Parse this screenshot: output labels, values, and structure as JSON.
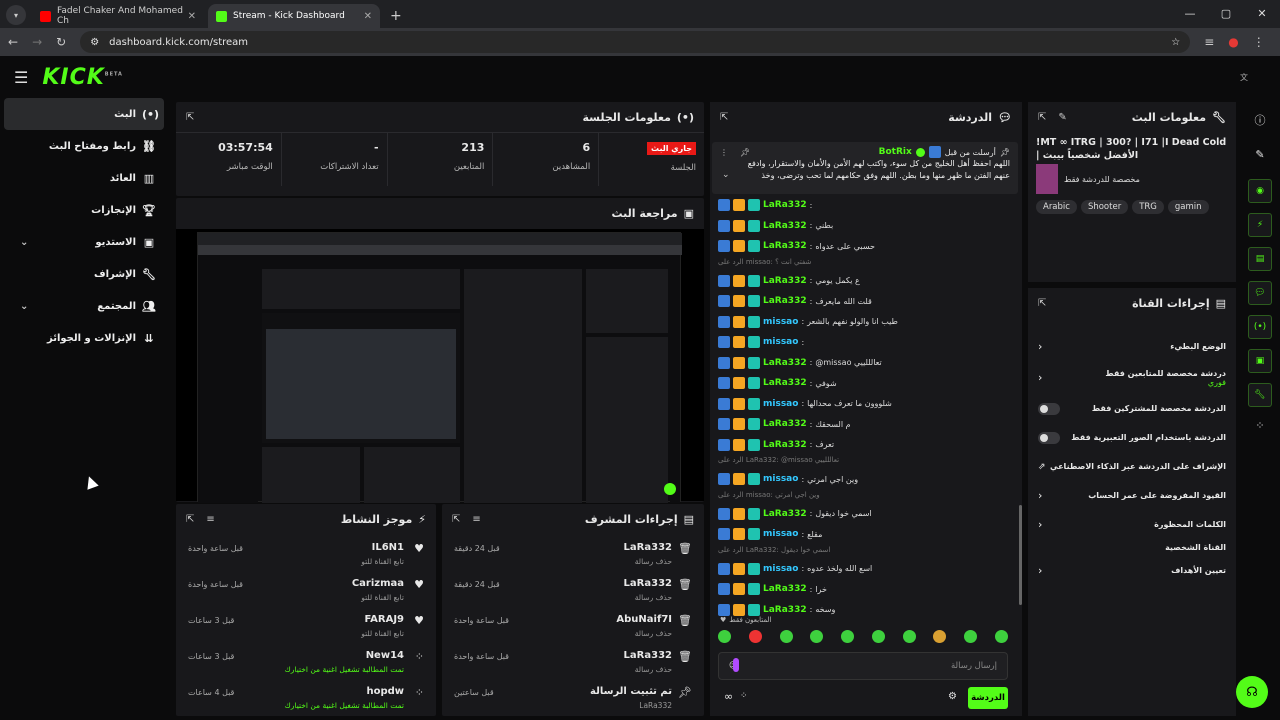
{
  "browser": {
    "tabs": [
      {
        "title": "Fadel Chaker And Mohamed Ch",
        "favicon_color": "#ff0000"
      },
      {
        "title": "Stream - Kick Dashboard",
        "favicon_color": "#53fc18"
      }
    ],
    "url": "dashboard.kick.com/stream"
  },
  "header": {
    "logo": "KICK",
    "logo_beta": "BETA"
  },
  "sidebar": {
    "items": [
      {
        "label": "البث",
        "icon": "broadcast-icon"
      },
      {
        "label": "رابط ومفتاح البث",
        "icon": "link-icon"
      },
      {
        "label": "العائد",
        "icon": "chart-icon"
      },
      {
        "label": "الإنجازات",
        "icon": "trophy-icon"
      },
      {
        "label": "الاستديو",
        "icon": "studio-icon"
      },
      {
        "label": "الإشراف",
        "icon": "wrench-icon"
      },
      {
        "label": "المجتمع",
        "icon": "community-icon"
      },
      {
        "label": "الإنزالات و الجوائز",
        "icon": "drops-icon"
      }
    ]
  },
  "session": {
    "title": "معلومات الجلسة",
    "live_badge": "جاري البث",
    "stats": [
      {
        "value": "03:57:54",
        "label": "الوقت مباشر"
      },
      {
        "value": "-",
        "label": "تعداد الاشتراكات"
      },
      {
        "value": "213",
        "label": "المتابعين"
      },
      {
        "value": "6",
        "label": "المشاهدين"
      },
      {
        "value": "",
        "label": "الجلسة"
      }
    ]
  },
  "preview": {
    "title": "مراجعة البث"
  },
  "activity": {
    "title": "موجز النشاط",
    "rows": [
      {
        "name": "IL6N1",
        "desc": "تابع القناة للتو",
        "time": "قبل ساعة واحدة",
        "icon": "heart-icon",
        "highlight": false
      },
      {
        "name": "Carizmaa",
        "desc": "تابع القناة للتو",
        "time": "قبل ساعة واحدة",
        "icon": "heart-icon",
        "highlight": false
      },
      {
        "name": "FARAJ9",
        "desc": "تابع القناة للتو",
        "time": "قبل 3 ساعات",
        "icon": "heart-icon",
        "highlight": false
      },
      {
        "name": "New14",
        "desc": "تمت المطالبة تشغيل اغنية من اختيارك",
        "time": "قبل 3 ساعات",
        "icon": "points-icon",
        "highlight": true
      },
      {
        "name": "hopdw",
        "desc": "تمت المطالبة تشغيل اغنية من اختيارك",
        "time": "قبل 4 ساعات",
        "icon": "points-icon",
        "highlight": true
      }
    ]
  },
  "modactions": {
    "title": "إجراءات المشرف",
    "rows": [
      {
        "name": "LaRa332",
        "desc": "حذف رسالة",
        "time": "قبل 24 دقيقة",
        "icon": "trash-icon"
      },
      {
        "name": "LaRa332",
        "desc": "حذف رسالة",
        "time": "قبل 24 دقيقة",
        "icon": "trash-icon"
      },
      {
        "name": "AbuNaif7I",
        "desc": "حذف رسالة",
        "time": "قبل ساعة واحدة",
        "icon": "trash-icon"
      },
      {
        "name": "LaRa332",
        "desc": "حذف رسالة",
        "time": "قبل ساعة واحدة",
        "icon": "trash-icon"
      },
      {
        "name": "تم تثبيت الرسالة",
        "desc": "LaRa332",
        "time": "قبل ساعتين",
        "icon": "pin-icon"
      }
    ]
  },
  "chat": {
    "title": "الدردشة",
    "pinned_by": "أرسلت من قبل",
    "pinned_user": "BotRix",
    "pinned_text": "اللهم احفظ أهل الخليج من كل سوء، واكتب لهم الأمن والأمان والاستقرار، وادفع عنهم الفتن ما ظهر منها وما بطن. اللهم وفق حكامهم لما تحب وترضى، وخذ بنواصيهم البر...",
    "messages": [
      {
        "user": "LaRa332",
        "msg": "",
        "reply": "",
        "color": "#53fc18"
      },
      {
        "user": "LaRa332",
        "msg": "بطني",
        "reply": "",
        "color": "#53fc18"
      },
      {
        "user": "LaRa332",
        "msg": "حسبي على عدواه",
        "reply": "",
        "color": "#53fc18"
      },
      {
        "user": "LaRa332",
        "msg": "ع يكمل يومي",
        "reply": "الرد على missao: شفتي انت ؟",
        "color": "#53fc18"
      },
      {
        "user": "LaRa332",
        "msg": "قلت الله مايعرف",
        "reply": "",
        "color": "#53fc18"
      },
      {
        "user": "missao",
        "msg": "طيب انا والولو نفهم بالشعر",
        "reply": "",
        "color": "#33c8ff"
      },
      {
        "user": "missao",
        "msg": "",
        "reply": "",
        "color": "#33c8ff"
      },
      {
        "user": "LaRa332",
        "msg": "@missao تعالللييي",
        "reply": "",
        "color": "#53fc18"
      },
      {
        "user": "LaRa332",
        "msg": "شوفي",
        "reply": "",
        "color": "#53fc18"
      },
      {
        "user": "missao",
        "msg": "شلووون ما تعرف محدالها",
        "reply": "",
        "color": "#33c8ff"
      },
      {
        "user": "LaRa332",
        "msg": "م السحقك",
        "reply": "",
        "color": "#53fc18"
      },
      {
        "user": "LaRa332",
        "msg": "تعرف",
        "reply": "",
        "color": "#53fc18"
      },
      {
        "user": "missao",
        "msg": "وين اجي امرتي",
        "reply": "الرد على LaRa332: @missao تعالللييي",
        "color": "#33c8ff"
      },
      {
        "user": "LaRa332",
        "msg": "اسمي خوا ديقول",
        "reply": "الرد على missao: وين اجي امرتي",
        "color": "#53fc18"
      },
      {
        "user": "missao",
        "msg": "مقلع",
        "reply": "",
        "color": "#33c8ff"
      },
      {
        "user": "missao",
        "msg": "اسع الله ولخذ عدوه",
        "reply": "الرد على LaRa332: اسمي خوا ديقول",
        "color": "#33c8ff"
      },
      {
        "user": "LaRa332",
        "msg": "خرا",
        "reply": "",
        "color": "#53fc18"
      },
      {
        "user": "LaRa332",
        "msg": "وسخه",
        "reply": "",
        "color": "#53fc18"
      }
    ],
    "followers_only": "المتابعون فقط",
    "input_placeholder": "إرسال رسالة",
    "send_label": "الدردشة"
  },
  "stream_info": {
    "title": "معلومات البث",
    "stream_title": "!MT ∞ ITRG | 300? | I71 |I Dead Cold | الأفضل شخصياً بيبث",
    "category": "مخصصة للدردشة فقط",
    "tags": [
      "Arabic",
      "Shooter",
      "TRG",
      "gamin"
    ]
  },
  "channel_actions": {
    "title": "إجراءات القناة",
    "rows": [
      {
        "label": "الوضع البطيء",
        "type": "chevron"
      },
      {
        "label": "دردشة مخصصة للمتابعين فقط",
        "sub": "فوري",
        "type": "chevron"
      },
      {
        "label": "الدردشة مخصصة للمشتركين فقط",
        "type": "toggle"
      },
      {
        "label": "الدردشة باستخدام الصور التعبيرية فقط",
        "type": "toggle"
      },
      {
        "label": "الإشراف على الدردشة عبر الذكاء الاصطناعي",
        "type": "external"
      },
      {
        "label": "القيود المفروضة على عمر الحساب",
        "type": "chevron"
      },
      {
        "label": "الكلمات المحظورة",
        "type": "chevron"
      }
    ],
    "section": "القناة الشخصية",
    "goal_label": "تعيين الأهداف"
  }
}
